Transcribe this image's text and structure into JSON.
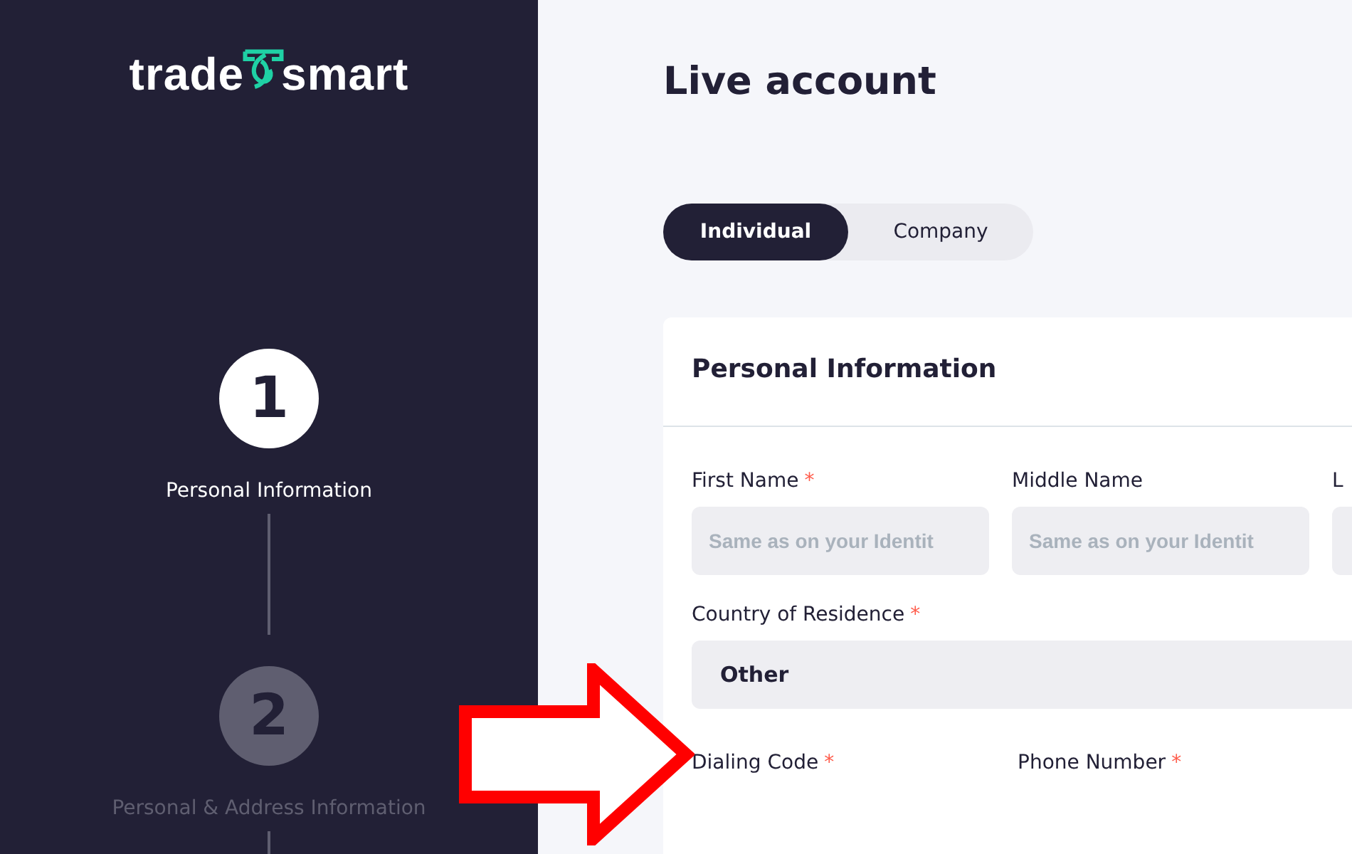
{
  "logo": {
    "left": "trade",
    "right": "smart"
  },
  "steps": [
    {
      "number": "1",
      "label": "Personal Information",
      "selected": true
    },
    {
      "number": "2",
      "label": "Personal & Address Information",
      "selected": false
    }
  ],
  "title": "Live account",
  "account_types": [
    {
      "label": "Individual",
      "selected": true
    },
    {
      "label": "Company",
      "selected": false
    }
  ],
  "card": {
    "title": "Personal Information",
    "name_fields": [
      {
        "label": "First Name",
        "required_mark": "*",
        "placeholder": "Same as on your Identit"
      },
      {
        "label": "Middle Name",
        "placeholder": "Same as on your Identit"
      },
      {
        "label": "L"
      }
    ],
    "country": {
      "label": "Country of Residence",
      "required_mark": "*",
      "value": "Other"
    },
    "phone_fields": [
      {
        "label": "Dialing Code",
        "required_mark": "*"
      },
      {
        "label": "Phone Number",
        "required_mark": "*"
      }
    ]
  }
}
